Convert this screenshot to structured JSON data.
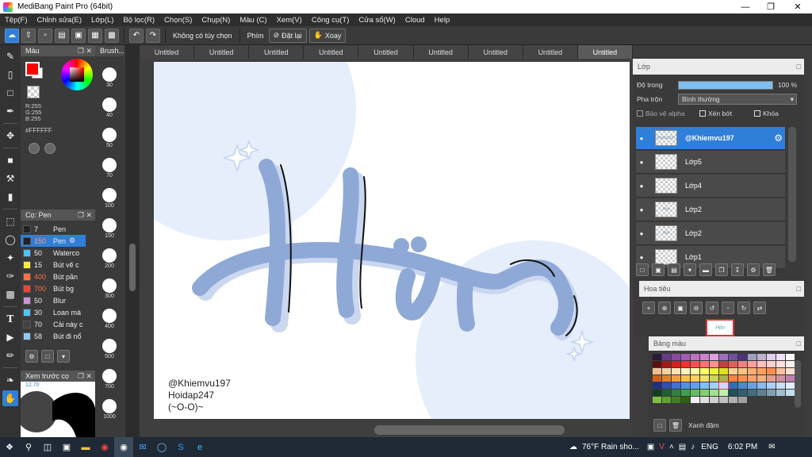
{
  "window": {
    "title": "MediBang Paint Pro (64bit)"
  },
  "menu": [
    "Tệp(F)",
    "Chỉnh sửa(E)",
    "Lớp(L)",
    "Bộ lọc(R)",
    "Chọn(S)",
    "Chụp(N)",
    "Màu (C)",
    "Xem(V)",
    "Công cụ(T)",
    "Cửa sổ(W)",
    "Cloud",
    "Help"
  ],
  "toolbar": {
    "option_label": "Không có tùy chọn",
    "key_label": "Phím",
    "reset_label": "Đặt lại",
    "rotate_label": "Xoay"
  },
  "color_panel": {
    "title": "Màu",
    "r": "R:255",
    "g": "G:255",
    "b": "B:255",
    "hex": "#FFFFFF",
    "fg_color": "#ff0000"
  },
  "brush_panel": {
    "title": "Cọ: Pen",
    "brushes": [
      {
        "size": "7",
        "name": "Pen",
        "color": "#222222"
      },
      {
        "size": "150",
        "name": "Pen",
        "color": "#222222",
        "selected": true
      },
      {
        "size": "50",
        "name": "Waterco",
        "color": "#4fc3f7"
      },
      {
        "size": "15",
        "name": "Bút vẽ c",
        "color": "#ffeb3b"
      },
      {
        "size": "400",
        "name": "Bút pần",
        "color": "#ff7043"
      },
      {
        "size": "700",
        "name": "Bút bg",
        "color": "#f44336"
      },
      {
        "size": "50",
        "name": "Blur",
        "color": "#ce93d8"
      },
      {
        "size": "30",
        "name": "Loan mà",
        "color": "#4fc3f7"
      },
      {
        "size": "70",
        "name": "Cải này c",
        "color": "#424242"
      },
      {
        "size": "58",
        "name": "Bút đi nổ",
        "color": "#90caf9"
      }
    ]
  },
  "preview_panel": {
    "title": "Xem trước cọ",
    "label": "12.70"
  },
  "brushsize_panel": {
    "title": "Brush...",
    "sizes": [
      "30",
      "40",
      "50",
      "70",
      "100",
      "150",
      "200",
      "300",
      "400",
      "500",
      "700",
      "1000"
    ]
  },
  "tabs": [
    "Untitled",
    "Untitled",
    "Untitled",
    "Untitled",
    "Untitled",
    "Untitled",
    "Untitled",
    "Untitled",
    "Untitled"
  ],
  "canvas": {
    "watermark_line1": "@Khiemvu197",
    "watermark_line2": "Hoidap247",
    "watermark_line3": "(~O-O)~",
    "art_text": "Hiin"
  },
  "layer_panel": {
    "title": "Lớp",
    "opacity_label": "Độ trong",
    "opacity_value": "100 %",
    "opacity_fraction": 1.0,
    "blend_label": "Pha trộn",
    "blend_value": "Bình thường",
    "protect_alpha": "Bảo vệ alpha",
    "clip": "Xén bớt",
    "lock": "Khóa",
    "layers": [
      {
        "name": "@Khiemvu197",
        "selected": true,
        "thumb": "Hoidap247"
      },
      {
        "name": "Lớp5",
        "thumb": ""
      },
      {
        "name": "Lớp4",
        "thumb": ""
      },
      {
        "name": "Lớp2",
        "thumb": "Hiin"
      },
      {
        "name": "Lớp2",
        "thumb": "Hiin"
      },
      {
        "name": "Lớp1",
        "thumb": ""
      }
    ]
  },
  "nav_panel": {
    "title": "Hoa tiêu",
    "thumb": "Hiin"
  },
  "palette_panel": {
    "title": "Bảng màu",
    "selected_name": "Xanh đậm"
  },
  "taskbar": {
    "weather": "76°F Rain sho...",
    "lang": "ENG",
    "time": "6:02 PM"
  }
}
